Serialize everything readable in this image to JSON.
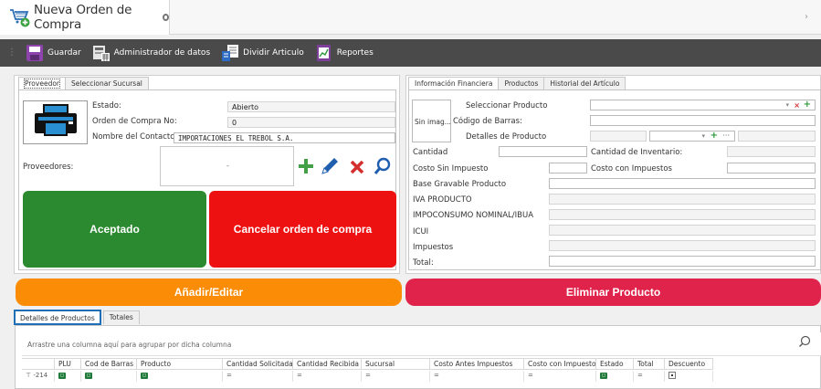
{
  "window": {
    "title": "Nueva Orden de Compra"
  },
  "toolbar": {
    "items": [
      {
        "label": "Guardar",
        "icon": "save-icon"
      },
      {
        "label": "Administrador de datos",
        "icon": "data-manager-icon"
      },
      {
        "label": "Dividir Articulo",
        "icon": "split-article-icon"
      },
      {
        "label": "Reportes",
        "icon": "reports-icon"
      }
    ]
  },
  "left_panel": {
    "tabs": [
      "Proveedor",
      "Seleccionar Sucursal"
    ],
    "estado_label": "Estado:",
    "estado_value": "Abierto",
    "orden_label": "Orden de Compra No:",
    "orden_value": "0",
    "contacto_label": "Nombre del Contacto:",
    "contacto_value": "IMPORTACIONES EL TREBOL S.A.",
    "proveedores_label": "Proveedores:",
    "proveedores_dropdown": "-",
    "aceptado_label": "Aceptado",
    "cancelar_label": "Cancelar orden de compra"
  },
  "right_panel": {
    "tabs": [
      "Información Financiera",
      "Productos",
      "Historial del Artículo"
    ],
    "image_placeholder": "Sin imag...",
    "seleccionar_producto_label": "Seleccionar Producto",
    "codigo_barras_label": "Código de Barras:",
    "detalles_producto_label": "Detalles de Producto",
    "cantidad_label": "Cantidad",
    "cantidad_inventario_label": "Cantidad de Inventario:",
    "costo_sin_label": "Costo Sin Impuesto",
    "costo_con_label": "Costo con Impuestos",
    "base_gravable_label": "Base Gravable Producto",
    "iva_label": "IVA PRODUCTO",
    "impoconsumo_label": "IMPOCONSUMO NOMINAL/IBUA",
    "icui_label": "ICUI",
    "impuestos_label": "Impuestos",
    "total_label": "Total:"
  },
  "actions": {
    "add_edit_label": "Añadir/Editar",
    "delete_label": "Eliminar Producto"
  },
  "bottom": {
    "tabs": [
      "Detalles de Productos",
      "Totales"
    ],
    "group_hint": "Arrastre una columna aquí para agrupar por dicha columna",
    "columns": [
      "",
      "PLU",
      "Cod de Barras",
      "Producto",
      "Cantidad Solicitada",
      "Cantidad Recibida",
      "Sucursal",
      "Costo Antes Impuestos",
      "Costo con Impuesto",
      "Estado",
      "Total",
      "Descuento"
    ],
    "filter_row_first": "-214"
  },
  "colors": {
    "toolbar_bg": "#4a4a4a",
    "green": "#2b8a2f",
    "red": "#ee1111",
    "orange": "#fb8c05",
    "crimson": "#e0234a",
    "tab_focus": "#1e6fb8"
  }
}
